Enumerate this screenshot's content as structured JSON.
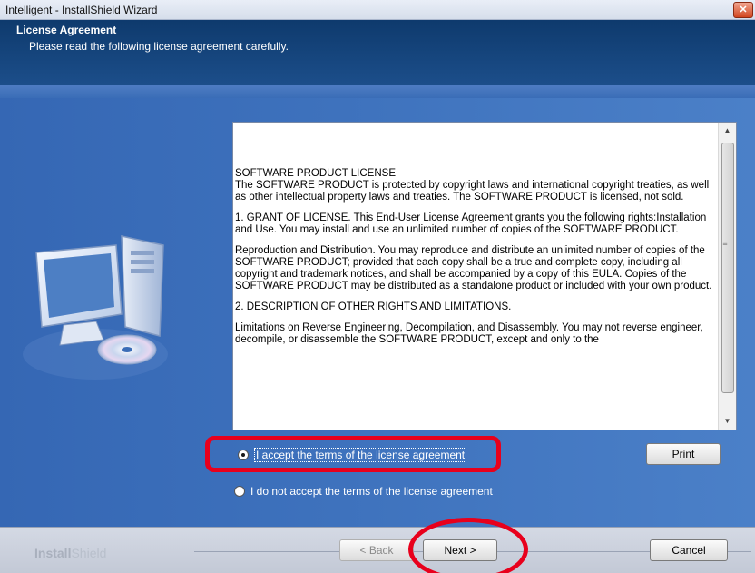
{
  "window": {
    "title": "Intelligent - InstallShield Wizard",
    "close_glyph": "✕"
  },
  "header": {
    "title": "License Agreement",
    "subtitle": "Please read the following license agreement carefully."
  },
  "license": {
    "paragraphs": [
      "SOFTWARE PRODUCT LICENSE\nThe SOFTWARE PRODUCT is protected by copyright laws and international copyright treaties, as well as other intellectual property laws and treaties. The SOFTWARE PRODUCT is licensed, not sold.",
      "1. GRANT OF LICENSE. This End-User License Agreement grants you the following rights:Installation and Use. You may install and use an unlimited number of copies of the SOFTWARE PRODUCT.",
      "Reproduction and Distribution. You may reproduce and distribute an unlimited number of copies of the SOFTWARE PRODUCT; provided that each copy shall be a true and complete copy, including all copyright and trademark notices, and shall be accompanied by a copy of this EULA. Copies of the SOFTWARE PRODUCT may be distributed as a standalone product or included with your own product.",
      "2. DESCRIPTION OF OTHER RIGHTS AND LIMITATIONS.",
      "Limitations on Reverse Engineering, Decompilation, and Disassembly. You may not reverse engineer, decompile, or disassemble the SOFTWARE PRODUCT, except and only to the"
    ]
  },
  "options": {
    "accept_label": "I accept the terms of the license agreement",
    "decline_label": "I do not accept the terms of the license agreement",
    "selected": "accept"
  },
  "buttons": {
    "print": "Print",
    "back": "< Back",
    "next": "Next >",
    "cancel": "Cancel"
  },
  "footer": {
    "brand_bold": "Install",
    "brand_light": "Shield"
  },
  "colors": {
    "header": "#0e3a6d",
    "body": "#3a6db7",
    "highlight": "#e8001c"
  },
  "icons": {
    "close": "close-icon",
    "computer": "computer-cd-icon",
    "scroll_up": "scroll-up-arrow-icon",
    "scroll_down": "scroll-down-arrow-icon"
  }
}
